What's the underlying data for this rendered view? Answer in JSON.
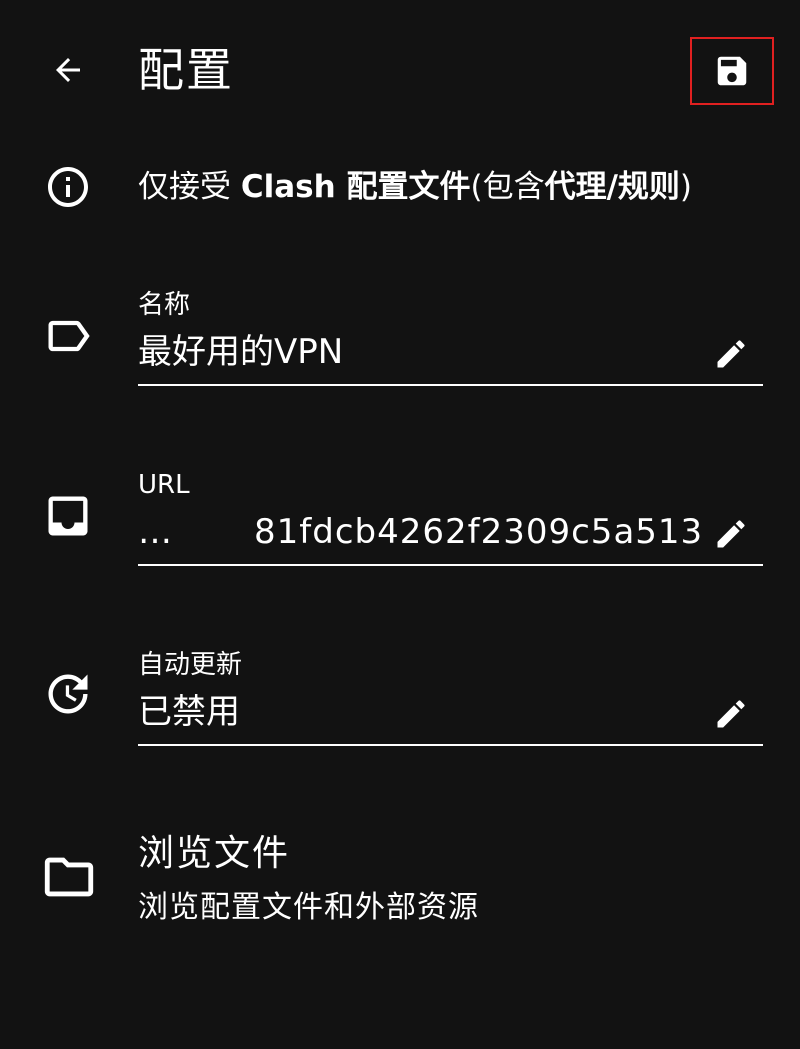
{
  "appbar": {
    "title": "配置",
    "back_icon": "arrow-back-icon",
    "save_icon": "save-icon"
  },
  "tip": {
    "icon": "info-icon",
    "prefix": "仅接受 ",
    "bold1": "Clash 配置文件",
    "mid": "(包含",
    "bold2": "代理",
    "slash": "/",
    "bold3": "规则",
    "suffix": ")"
  },
  "fields": {
    "name": {
      "icon": "label-icon",
      "label": "名称",
      "value": "最好用的VPN"
    },
    "url": {
      "icon": "inbox-icon",
      "label": "URL",
      "ellipsis": "…",
      "value": "81fdcb4262f2309c5a513"
    },
    "auto_update": {
      "icon": "update-icon",
      "label": "自动更新",
      "value": "已禁用"
    }
  },
  "browse": {
    "icon": "folder-icon",
    "title": "浏览文件",
    "subtitle": "浏览配置文件和外部资源"
  },
  "colors": {
    "background": "#121212",
    "foreground": "#ffffff",
    "highlight_border": "#e02020"
  }
}
